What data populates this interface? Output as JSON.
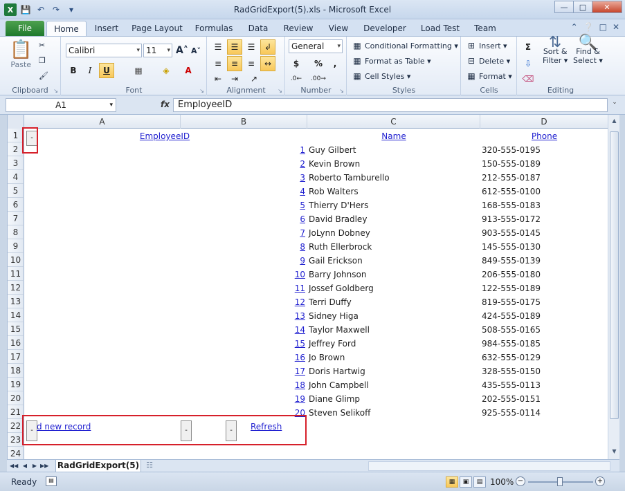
{
  "window": {
    "title": "RadGridExport(5).xls - Microsoft Excel",
    "app_icon": "X",
    "controls": [
      "—",
      "□",
      "✕"
    ]
  },
  "ribbon_tabs": [
    "File",
    "Home",
    "Insert",
    "Page Layout",
    "Formulas",
    "Data",
    "Review",
    "View",
    "Developer",
    "Load Test",
    "Team"
  ],
  "ribbon": {
    "clipboard": {
      "label": "Clipboard",
      "paste": "Paste"
    },
    "font": {
      "label": "Font",
      "name": "Calibri",
      "size": "11",
      "bold": "B",
      "italic": "I",
      "underline": "U"
    },
    "alignment": {
      "label": "Alignment"
    },
    "number": {
      "label": "Number",
      "format": "General",
      "currency": "$",
      "percent": "%",
      "comma": ","
    },
    "styles": {
      "label": "Styles",
      "conditional": "Conditional Formatting",
      "format_table": "Format as Table",
      "cell_styles": "Cell Styles"
    },
    "cells": {
      "label": "Cells",
      "insert": "Insert",
      "delete": "Delete",
      "format": "Format"
    },
    "editing": {
      "label": "Editing",
      "sort_line1": "Sort &",
      "sort_line2": "Filter",
      "find_line1": "Find &",
      "find_line2": "Select"
    }
  },
  "formula_bar": {
    "name_box": "A1",
    "fx": "fx",
    "content": "EmployeeID"
  },
  "columns": [
    "A",
    "B",
    "C",
    "D"
  ],
  "rows": [
    "1",
    "2",
    "3",
    "4",
    "5",
    "6",
    "7",
    "8",
    "9",
    "10",
    "11",
    "12",
    "13",
    "14",
    "15",
    "16",
    "17",
    "18",
    "19",
    "20",
    "21",
    "22",
    "23",
    "24"
  ],
  "grid": {
    "headers": {
      "employee_id": "EmployeeID",
      "name": "Name",
      "phone": "Phone"
    },
    "records": [
      {
        "id": "1",
        "name": "Guy Gilbert",
        "phone": "320-555-0195"
      },
      {
        "id": "2",
        "name": "Kevin Brown",
        "phone": "150-555-0189"
      },
      {
        "id": "3",
        "name": "Roberto Tamburello",
        "phone": "212-555-0187"
      },
      {
        "id": "4",
        "name": "Rob Walters",
        "phone": "612-555-0100"
      },
      {
        "id": "5",
        "name": "Thierry D'Hers",
        "phone": "168-555-0183"
      },
      {
        "id": "6",
        "name": "David Bradley",
        "phone": "913-555-0172"
      },
      {
        "id": "7",
        "name": "JoLynn Dobney",
        "phone": "903-555-0145"
      },
      {
        "id": "8",
        "name": "Ruth Ellerbrock",
        "phone": "145-555-0130"
      },
      {
        "id": "9",
        "name": "Gail Erickson",
        "phone": "849-555-0139"
      },
      {
        "id": "10",
        "name": "Barry Johnson",
        "phone": "206-555-0180"
      },
      {
        "id": "11",
        "name": "Jossef Goldberg",
        "phone": "122-555-0189"
      },
      {
        "id": "12",
        "name": "Terri Duffy",
        "phone": "819-555-0175"
      },
      {
        "id": "13",
        "name": "Sidney Higa",
        "phone": "424-555-0189"
      },
      {
        "id": "14",
        "name": "Taylor Maxwell",
        "phone": "508-555-0165"
      },
      {
        "id": "15",
        "name": "Jeffrey Ford",
        "phone": "984-555-0185"
      },
      {
        "id": "16",
        "name": "Jo Brown",
        "phone": "632-555-0129"
      },
      {
        "id": "17",
        "name": "Doris Hartwig",
        "phone": "328-555-0150"
      },
      {
        "id": "18",
        "name": "John Campbell",
        "phone": "435-555-0113"
      },
      {
        "id": "19",
        "name": "Diane Glimp",
        "phone": "202-555-0151"
      },
      {
        "id": "20",
        "name": "Steven Selikoff",
        "phone": "925-555-0114"
      }
    ],
    "add_record": "d new record",
    "refresh": "Refresh",
    "mini_button_glyph": "-"
  },
  "sheet_tabs": {
    "active": "RadGridExport(5)"
  },
  "status": {
    "text": "Ready",
    "zoom": "100%"
  },
  "colors": {
    "link": "#1f1fd0",
    "highlight_box": "#d6202a",
    "file_tab": "#1f7a2e"
  }
}
